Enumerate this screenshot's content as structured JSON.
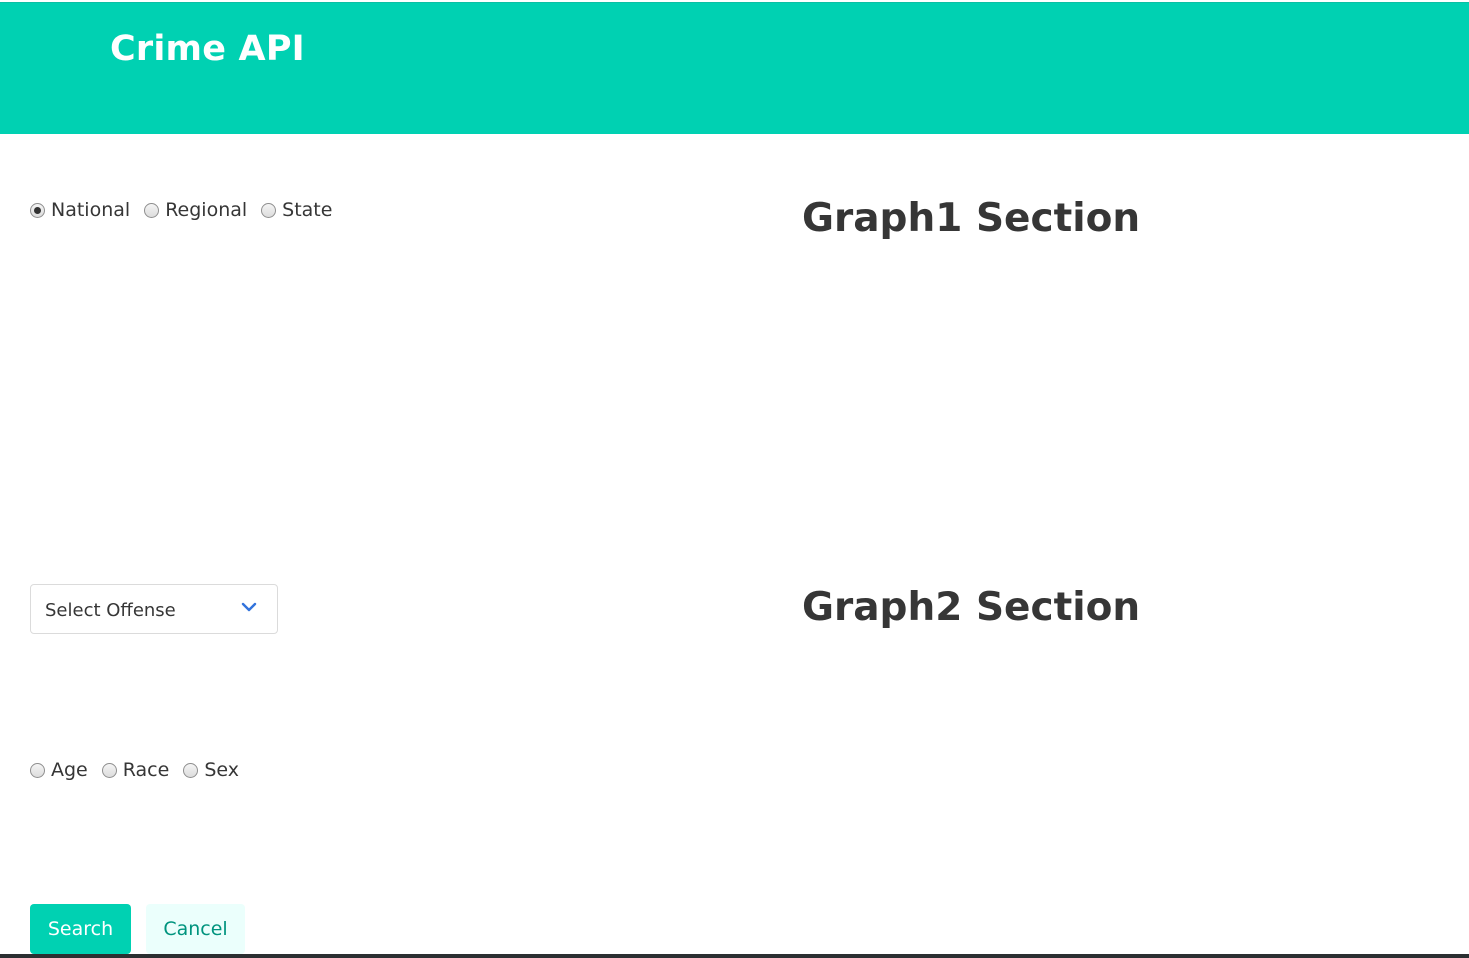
{
  "header": {
    "title": "Crime API"
  },
  "scope_filter": {
    "options": [
      {
        "label": "National",
        "checked": true
      },
      {
        "label": "Regional",
        "checked": false
      },
      {
        "label": "State",
        "checked": false
      }
    ]
  },
  "offense_select": {
    "value": "Select Offense",
    "icon": "chevron-down-icon"
  },
  "demographic_filter": {
    "options": [
      {
        "label": "Age",
        "checked": false
      },
      {
        "label": "Race",
        "checked": false
      },
      {
        "label": "Sex",
        "checked": false
      }
    ]
  },
  "sections": {
    "graph1_title": "Graph1 Section",
    "graph2_title": "Graph2 Section"
  },
  "actions": {
    "search_label": "Search",
    "cancel_label": "Cancel"
  },
  "colors": {
    "primary": "#00d1b2",
    "primary_light": "#ebfffc",
    "primary_dark_text": "#00947e",
    "chevron": "#3273dc",
    "text": "#363636"
  }
}
